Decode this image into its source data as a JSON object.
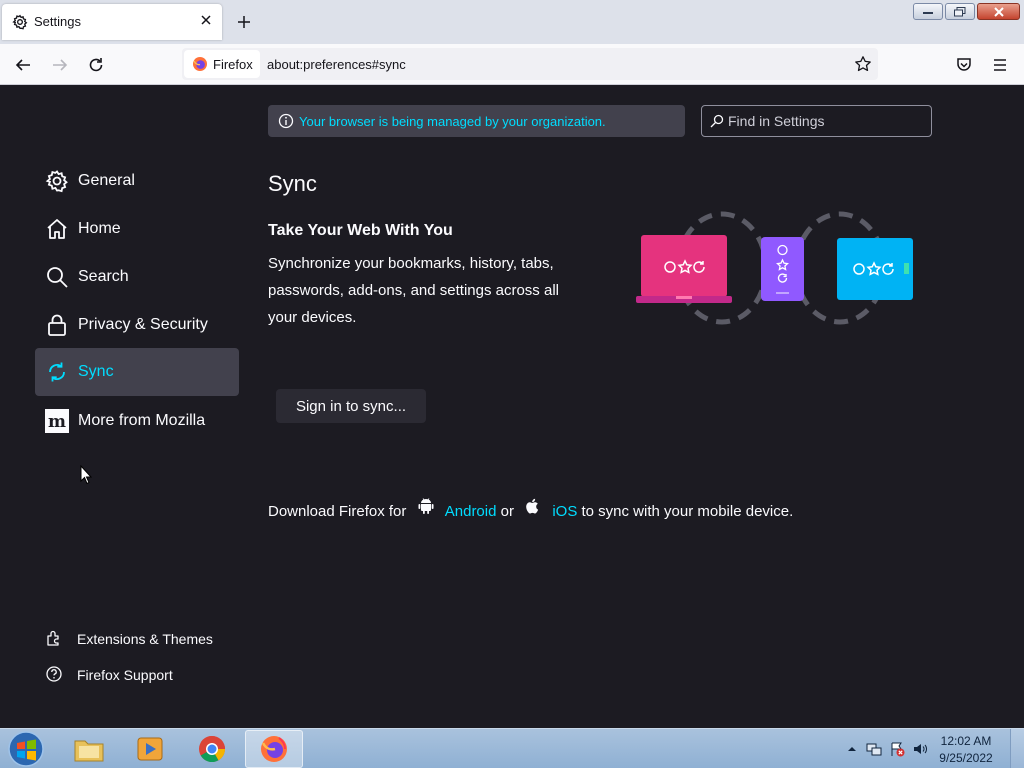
{
  "browser": {
    "tab": {
      "title": "Settings",
      "icon": "gear-icon"
    },
    "identity_label": "Firefox",
    "url": "about:preferences#sync"
  },
  "banner": {
    "policy_text": "Your browser is being managed by your organization."
  },
  "search": {
    "placeholder": "Find in Settings"
  },
  "sidebar": {
    "categories": [
      {
        "label": "General",
        "icon": "gear-icon"
      },
      {
        "label": "Home",
        "icon": "home-icon"
      },
      {
        "label": "Search",
        "icon": "search-icon"
      },
      {
        "label": "Privacy & Security",
        "icon": "lock-icon"
      },
      {
        "label": "Sync",
        "icon": "sync-icon",
        "selected": true
      },
      {
        "label": "More from Mozilla",
        "icon": "mozilla-icon"
      }
    ],
    "footer": [
      {
        "label": "Extensions & Themes",
        "icon": "extensions-icon"
      },
      {
        "label": "Firefox Support",
        "icon": "help-icon"
      }
    ]
  },
  "sync": {
    "title": "Sync",
    "subtitle": "Take Your Web With You",
    "description": "Synchronize your bookmarks, history, tabs, passwords, add-ons, and settings across all your devices.",
    "signin_label": "Sign in to sync...",
    "mobile": {
      "prefix": "Download Firefox for",
      "android": "Android",
      "or": "or",
      "ios": "iOS",
      "suffix": "to sync with your mobile device."
    }
  },
  "taskbar": {
    "items": [
      "explorer-icon",
      "media-player-icon",
      "chrome-icon",
      "firefox-icon"
    ],
    "active_item": "firefox-icon",
    "time": "12:02 AM",
    "date": "9/25/2022"
  },
  "colors": {
    "accent": "#00ddff",
    "background": "#1c1b22",
    "selected_bg": "#42414d"
  }
}
